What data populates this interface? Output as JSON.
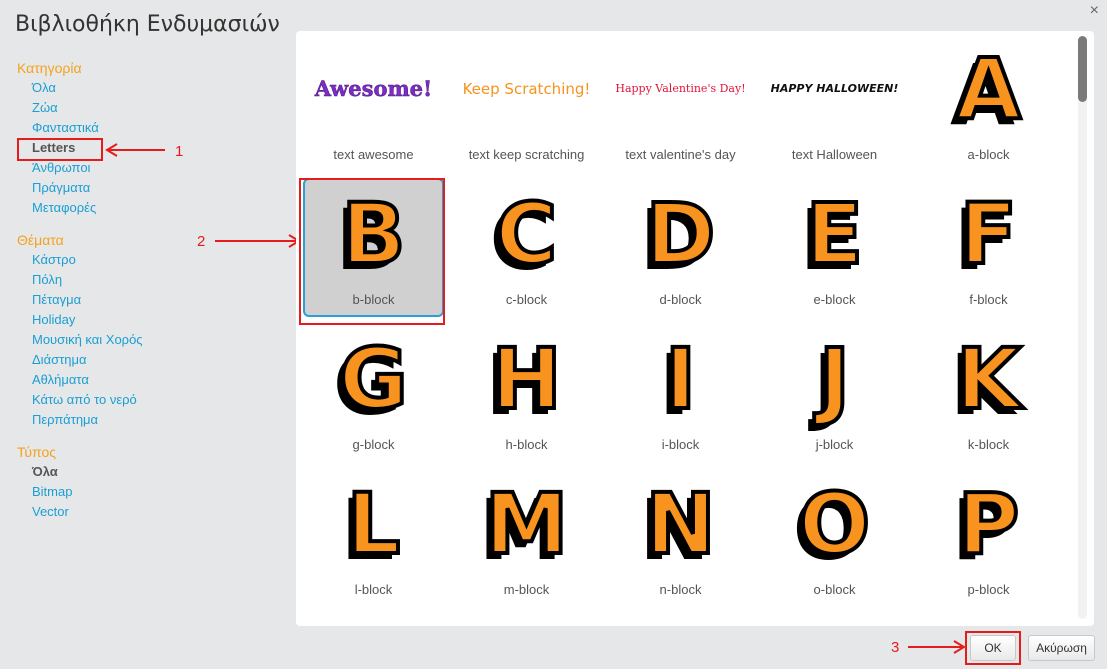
{
  "window": {
    "title": "Βιβλιοθήκη Ενδυμασιών",
    "close_glyph": "×"
  },
  "sidebar": {
    "category": {
      "heading": "Κατηγορία",
      "items": [
        "Όλα",
        "Ζώα",
        "Φανταστικά",
        "Letters",
        "Άνθρωποι",
        "Πράγματα",
        "Μεταφορές"
      ],
      "selected": "Letters"
    },
    "themes": {
      "heading": "Θέματα",
      "items": [
        "Κάστρο",
        "Πόλη",
        "Πέταγμα",
        "Holiday",
        "Μουσική και Χορός",
        "Διάστημα",
        "Αθλήματα",
        "Κάτω από το νερό",
        "Περπάτημα"
      ]
    },
    "type": {
      "heading": "Τύπος",
      "items": [
        "Όλα",
        "Bitmap",
        "Vector"
      ],
      "selected": "Όλα"
    }
  },
  "costumes": [
    {
      "label": "text awesome",
      "art": "Awesome!"
    },
    {
      "label": "text keep scratching",
      "art": "Keep Scratching!"
    },
    {
      "label": "text valentine's day",
      "art": "Happy Valentine's Day!"
    },
    {
      "label": "text Halloween",
      "art": "HAPPY HALLOWEEN!"
    },
    {
      "label": "a-block",
      "art": "A"
    },
    {
      "label": "b-block",
      "art": "B"
    },
    {
      "label": "c-block",
      "art": "C"
    },
    {
      "label": "d-block",
      "art": "D"
    },
    {
      "label": "e-block",
      "art": "E"
    },
    {
      "label": "f-block",
      "art": "F"
    },
    {
      "label": "g-block",
      "art": "G"
    },
    {
      "label": "h-block",
      "art": "H"
    },
    {
      "label": "i-block",
      "art": "I"
    },
    {
      "label": "j-block",
      "art": "J"
    },
    {
      "label": "k-block",
      "art": "K"
    },
    {
      "label": "l-block",
      "art": "L"
    },
    {
      "label": "m-block",
      "art": "M"
    },
    {
      "label": "n-block",
      "art": "N"
    },
    {
      "label": "o-block",
      "art": "O"
    },
    {
      "label": "p-block",
      "art": "P"
    }
  ],
  "selected_costume": "b-block",
  "buttons": {
    "ok": "OK",
    "cancel": "Ακύρωση"
  },
  "annotations": {
    "n1": "1",
    "n2": "2",
    "n3": "3"
  },
  "colors": {
    "accent_orange": "#f4a21e",
    "link_blue": "#1a9fd4",
    "annotation_red": "#e51c1c",
    "selection_blue": "#2b9fd3"
  }
}
